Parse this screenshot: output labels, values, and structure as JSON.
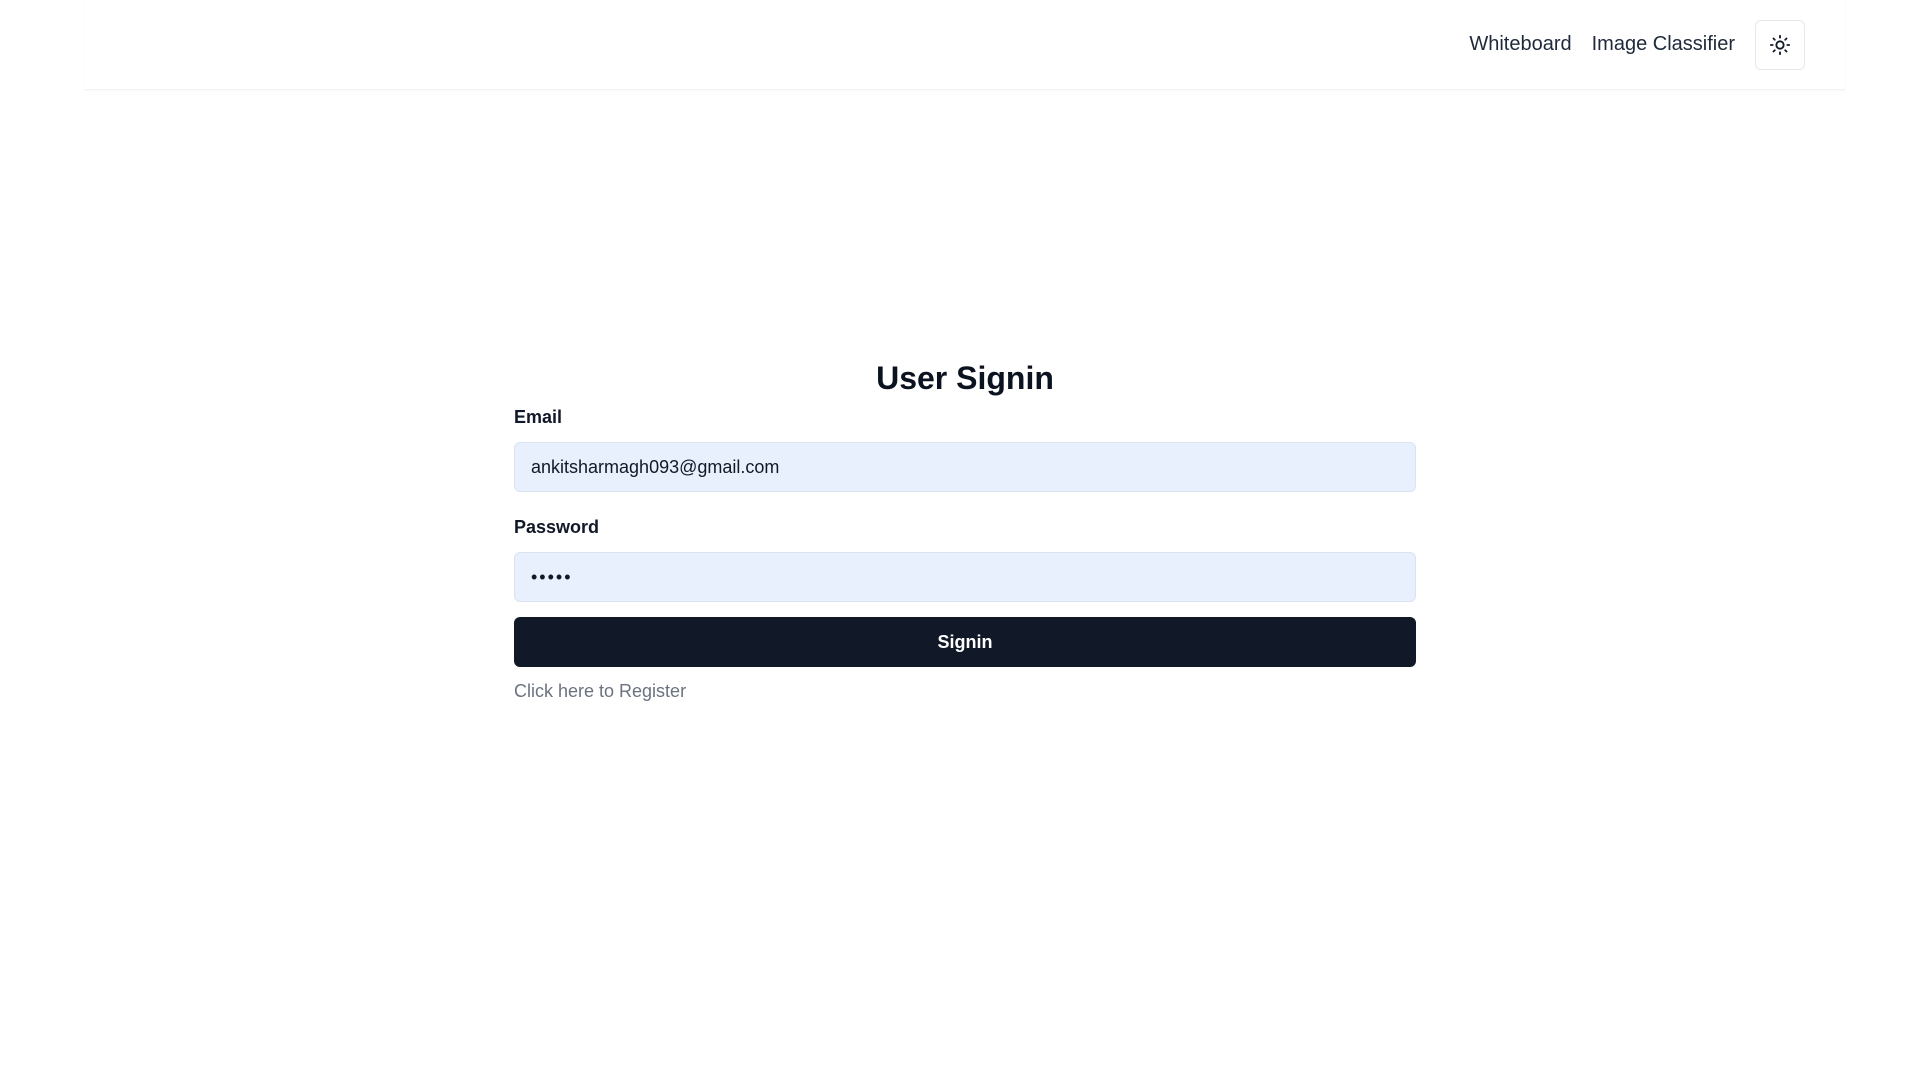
{
  "nav": {
    "links": [
      "Whiteboard",
      "Image Classifier"
    ],
    "theme_toggle_icon": "sun-icon"
  },
  "form": {
    "title": "User Signin",
    "email_label": "Email",
    "email_value": "ankitsharmagh093@gmail.com",
    "password_label": "Password",
    "password_value": "•••••",
    "submit_label": "Signin",
    "register_link": "Click here to Register"
  },
  "colors": {
    "button_bg": "#111827",
    "input_bg": "#e8f0fe",
    "link_muted": "#6b7280"
  }
}
